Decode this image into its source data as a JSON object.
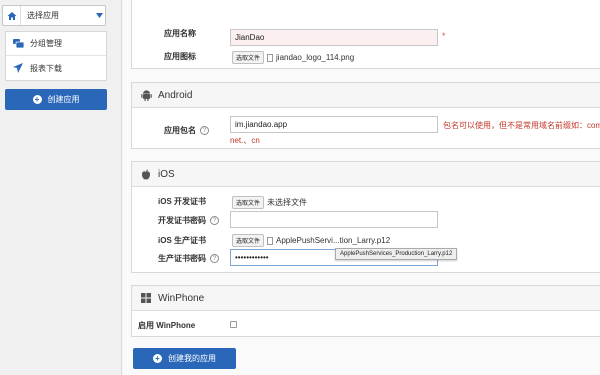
{
  "sidebar": {
    "app_select_label": "选择应用",
    "menu": [
      {
        "label": "分组管理",
        "icon": "groups-icon"
      },
      {
        "label": "报表下载",
        "icon": "send-icon"
      }
    ],
    "create_app_label": "创建应用"
  },
  "basic": {
    "app_name_label": "应用名称",
    "app_name_value": "JianDao",
    "required_mark": "*",
    "app_icon_label": "应用图标",
    "file_button": "选取文件",
    "icon_file": "jiandao_logo_114.png"
  },
  "android": {
    "title": "Android",
    "package_label": "应用包名",
    "help": "?",
    "package_value": "im.jiandao.app",
    "hint_line1": "包名可以使用，但不是常用域名前缀如：com.、",
    "hint_line2": "net.、cn"
  },
  "ios": {
    "title": "iOS",
    "dev_cert_label": "iOS 开发证书",
    "dev_cert_file": "未选择文件",
    "dev_pwd_label": "开发证书密码",
    "prod_cert_label": "iOS 生产证书",
    "prod_cert_file": "ApplePushServi...tion_Larry.p12",
    "prod_pwd_label": "生产证书密码",
    "prod_pwd_value": "••••••••••••",
    "tooltip": "ApplePushServices_Production_Larry.p12"
  },
  "winphone": {
    "title": "WinPhone",
    "enable_label": "启用 WinPhone"
  },
  "submit_label": "创建我的应用",
  "colors": {
    "primary": "#2a67b8",
    "warning": "#c0392b"
  }
}
